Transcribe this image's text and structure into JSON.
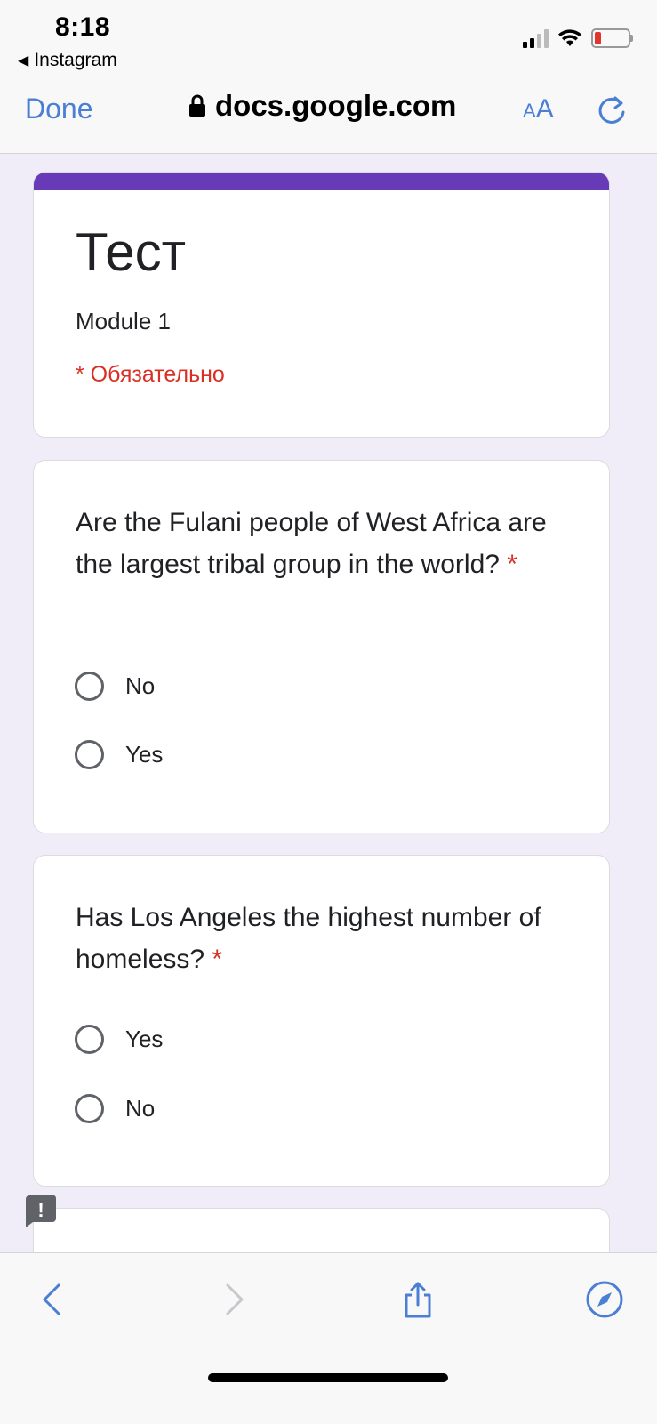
{
  "status_bar": {
    "time": "8:18",
    "back_app": "Instagram",
    "battery_color": "#e3342f"
  },
  "browser": {
    "done_label": "Done",
    "url": "docs.google.com",
    "aa_small": "A",
    "aa_large": "A",
    "accent_color": "#4a7fd4"
  },
  "form": {
    "accent_color": "#673ab7",
    "title": "Тест",
    "description": "Module 1",
    "required_note": "* Обязательно",
    "questions": [
      {
        "text": "Are the Fulani people of West Africa are the largest tribal group in the world?",
        "required_mark": "*",
        "options": [
          "No",
          "Yes"
        ]
      },
      {
        "text": "Has Los Angeles the highest number of homeless?",
        "required_mark": "*",
        "options": [
          "Yes",
          "No"
        ]
      }
    ]
  },
  "feedback_badge": "!",
  "toolbar": {
    "icons": [
      "back-arrow-icon",
      "forward-arrow-icon",
      "share-icon",
      "compass-icon"
    ]
  }
}
